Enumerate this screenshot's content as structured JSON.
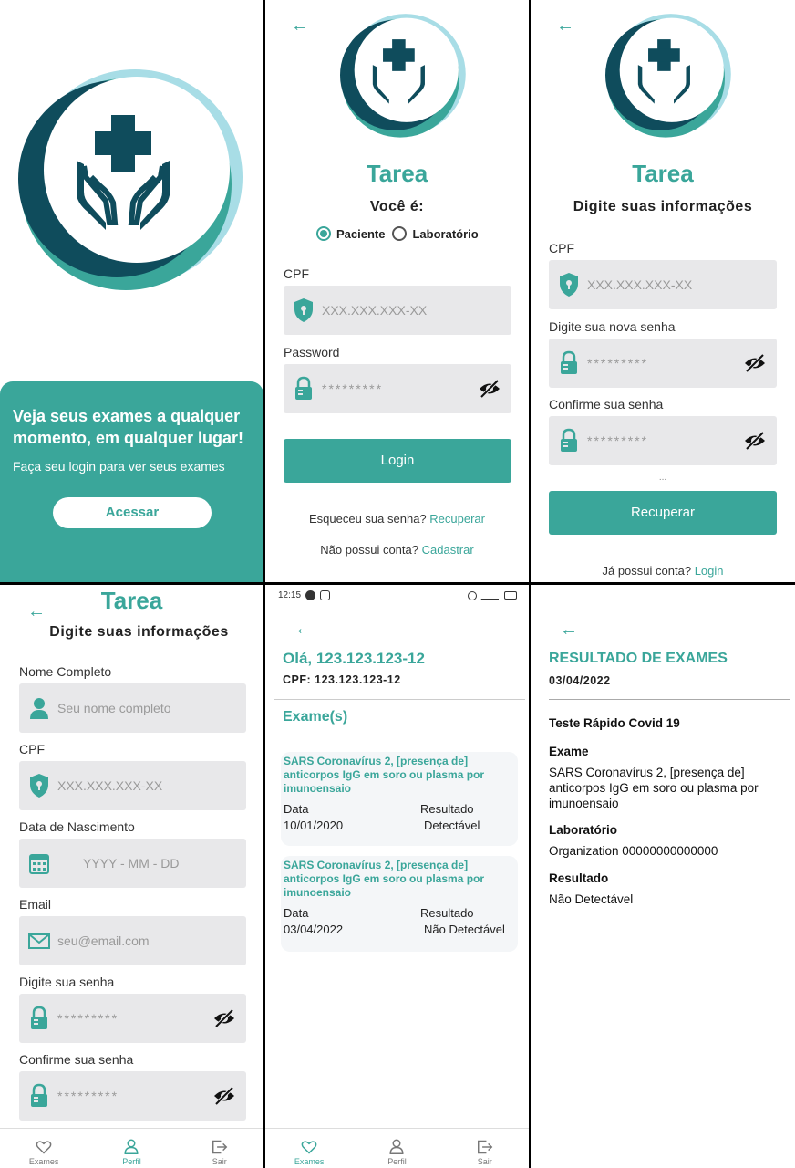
{
  "brand": "Tarea",
  "splash": {
    "headline": "Veja seus exames a qualquer momento, em qualquer lugar!",
    "subtext": "Faça seu login para ver seus exames",
    "button": "Acessar"
  },
  "login": {
    "question": "Você é:",
    "radio_patient": "Paciente",
    "radio_lab": "Laboratório",
    "cpf_label": "CPF",
    "cpf_placeholder": "XXX.XXX.XXX-XX",
    "password_label": "Password",
    "password_placeholder": "*********",
    "login_button": "Login",
    "forgot_text": "Esqueceu sua senha?",
    "forgot_link": "Recuperar",
    "noaccount_text": "Não possui conta?",
    "noaccount_link": "Cadastrar"
  },
  "recover": {
    "title": "Digite suas informações",
    "cpf_label": "CPF",
    "cpf_placeholder": "XXX.XXX.XXX-XX",
    "newpass_label": "Digite sua nova senha",
    "newpass_placeholder": "*********",
    "confirm_label": "Confirme sua senha",
    "confirm_placeholder": "*********",
    "ellipsis": "...",
    "button": "Recuperar",
    "have_account": "Já possui conta?",
    "login_link": "Login"
  },
  "register": {
    "title": "Digite suas informações",
    "name_label": "Nome Completo",
    "name_placeholder": "Seu nome completo",
    "cpf_label": "CPF",
    "cpf_placeholder": "XXX.XXX.XXX-XX",
    "birth_label": "Data de Nascimento",
    "birth_placeholder": "YYYY - MM - DD",
    "email_label": "Email",
    "email_placeholder": "seu@email.com",
    "pass_label": "Digite sua senha",
    "pass_placeholder": "*********",
    "confirm_label": "Confirme sua senha",
    "confirm_placeholder": "*********"
  },
  "nav": {
    "exams": "Exames",
    "profile": "Perfil",
    "exit": "Sair"
  },
  "home": {
    "status_time": "12:15",
    "greeting": "Olá, 123.123.123-12",
    "cpf_line": "CPF: 123.123.123-12",
    "section": "Exame(s)",
    "exams": [
      {
        "title": "SARS Coronavírus 2, [presença de] anticorpos IgG em soro ou plasma por imunoensaio",
        "date_label": "Data",
        "date": "10/01/2020",
        "result_label": "Resultado",
        "result": "Detectável"
      },
      {
        "title": "SARS Coronavírus 2, [presença de] anticorpos IgG em soro ou plasma por imunoensaio",
        "date_label": "Data",
        "date": "03/04/2022",
        "result_label": "Resultado",
        "result": "Não Detectável"
      }
    ]
  },
  "result": {
    "title": "RESULTADO DE EXAMES",
    "date": "03/04/2022",
    "test_name": "Teste Rápido Covid 19",
    "exam_label": "Exame",
    "exam_value": "SARS Coronavírus 2, [presença de] anticorpos IgG em soro ou plasma por imunoensaio",
    "lab_label": "Laboratório",
    "lab_value": "Organization 00000000000000",
    "result_label": "Resultado",
    "result_value": "Não Detectável"
  },
  "colors": {
    "accent": "#3aa69a",
    "dark": "#0f4c5c",
    "light": "#a8dde6",
    "field_bg": "#e8e8ea"
  }
}
